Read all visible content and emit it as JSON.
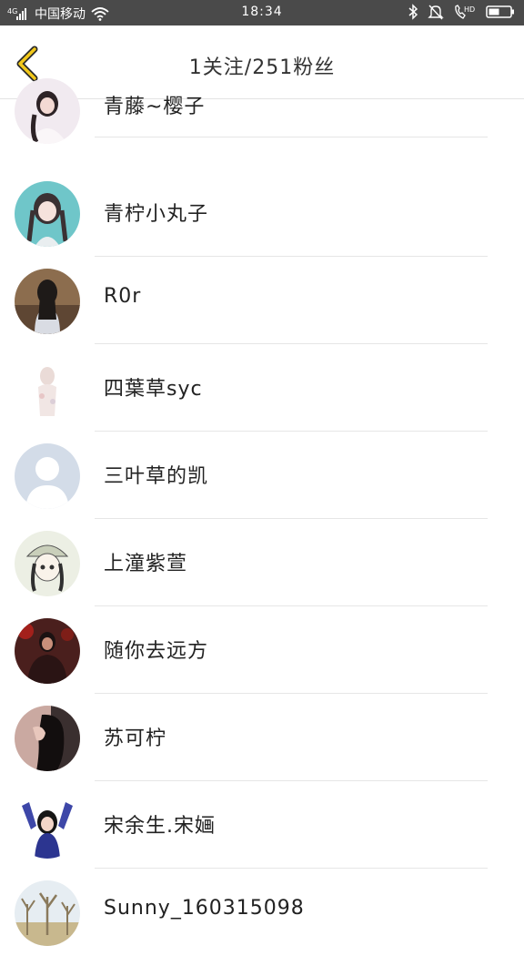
{
  "status_bar": {
    "network": "4G",
    "carrier": "中国移动",
    "time": "18:34",
    "hd_label": "HD",
    "icons": [
      "signal-icon",
      "wifi-icon",
      "bluetooth-icon",
      "mute-icon",
      "call-hd-icon",
      "battery-icon"
    ]
  },
  "header": {
    "title": "1关注/251粉丝",
    "back_icon": "chevron-left-icon",
    "accent_color": "#f2c81a"
  },
  "followers": [
    {
      "name": "青藤~樱子",
      "avatar": "girl-white-dress"
    },
    {
      "name": "青柠小丸子",
      "avatar": "girl-teal-background"
    },
    {
      "name": "R0r",
      "avatar": "girl-back-view"
    },
    {
      "name": "四葉草syc",
      "avatar": "faded-figure"
    },
    {
      "name": "三叶草的凯",
      "avatar": "default-avatar"
    },
    {
      "name": "上潼紫萱",
      "avatar": "anime-girl-hat"
    },
    {
      "name": "随你去远方",
      "avatar": "man-red-background"
    },
    {
      "name": "苏可柠",
      "avatar": "girl-dark-profile"
    },
    {
      "name": "宋余生.宋婳",
      "avatar": "girl-arms-raised"
    },
    {
      "name": "Sunny_160315098",
      "avatar": "trees-outdoor"
    }
  ]
}
